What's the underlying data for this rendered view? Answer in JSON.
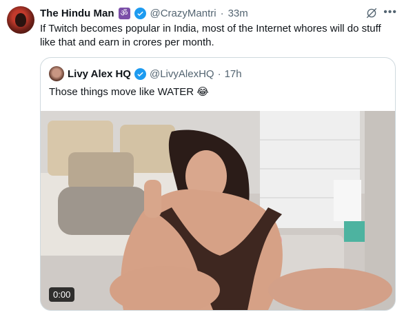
{
  "tweet": {
    "display_name": "The Hindu Man",
    "badge_glyph": "ॐ",
    "handle": "@CrazyMantri",
    "separator": "·",
    "time": "33m",
    "text": "If Twitch becomes popular in India, most of the Internet whores will do stuff like that and earn in crores per month."
  },
  "quoted": {
    "display_name": "Livy Alex HQ",
    "handle": "@LivyAlexHQ",
    "separator": "·",
    "time": "17h",
    "text": "Those things move like WATER 😂",
    "video": {
      "duration": "0:00"
    }
  },
  "colors": {
    "accent": "#1d9bf0",
    "text": "#0f1419",
    "muted": "#536471",
    "border": "#cfd9de",
    "om_badge": "#7b4fa8"
  },
  "icons": [
    "verified-badge-icon",
    "grok-icon",
    "more-icon"
  ]
}
